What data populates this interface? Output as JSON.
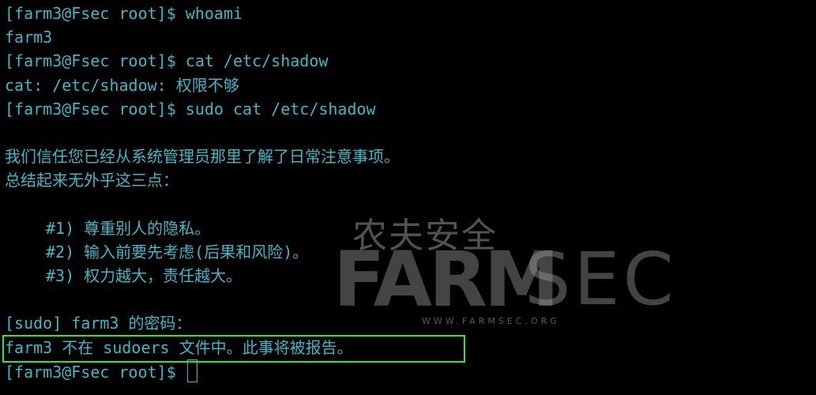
{
  "terminal": {
    "colors": {
      "background": "#000000",
      "text": "#3fb8c8",
      "highlight": "#2ee82e"
    },
    "lines": [
      "[farm3@Fsec root]$ whoami",
      "farm3",
      "[farm3@Fsec root]$ cat /etc/shadow",
      "cat: /etc/shadow: 权限不够",
      "[farm3@Fsec root]$ sudo cat /etc/shadow",
      "",
      "我们信任您已经从系统管理员那里了解了日常注意事项。",
      "总结起来无外乎这三点：",
      "",
      "#1) 尊重别人的隐私。",
      "#2) 输入前要先考虑(后果和风险)。",
      "#3) 权力越大，责任越大。",
      "",
      "[sudo] farm3 的密码：",
      "farm3 不在 sudoers 文件中。此事将被报告。",
      "[farm3@Fsec root]$ "
    ]
  },
  "watermark": {
    "cn": "农夫安全",
    "farm": "FARM",
    "sec": "SEC",
    "url": "WWW.FARMSEC.ORG"
  }
}
